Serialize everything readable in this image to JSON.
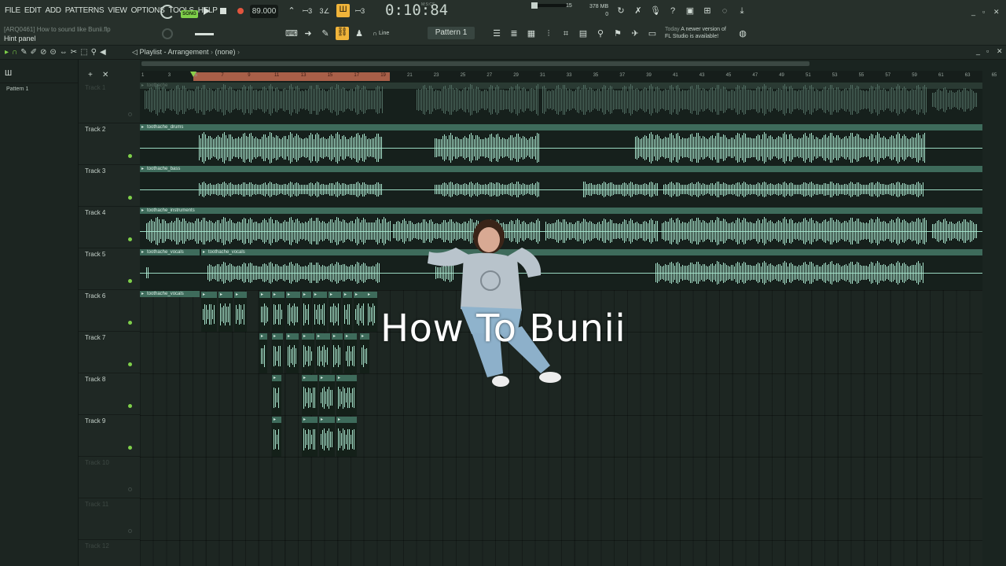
{
  "menu": [
    "FILE",
    "EDIT",
    "ADD",
    "PATTERNS",
    "VIEW",
    "OPTIONS",
    "TOOLS",
    "HELP"
  ],
  "project": "[ARQ0461] How to sound like Bunii.flp",
  "hint_panel": "Hint panel",
  "song_mode": "SONG",
  "tempo": "89.000",
  "time": "0:10:84",
  "time_label": "M:S:CS",
  "cpu_value": "15",
  "memory": "378 MB",
  "memory_sub": "0",
  "snap": "Line",
  "pattern": "Pattern 1",
  "news": {
    "date": "Today",
    "line1": "A newer version of",
    "line2": "FL Studio is available!"
  },
  "playlist_title": "Playlist - Arrangement",
  "playlist_sub": "(none)",
  "picker_items": [
    "Pattern 1"
  ],
  "ruler_numbers": [
    "1",
    "3",
    "5",
    "7",
    "9",
    "11",
    "13",
    "15",
    "17",
    "19",
    "21",
    "23",
    "25",
    "27",
    "29",
    "31",
    "33",
    "35",
    "37",
    "39",
    "41",
    "43",
    "45",
    "47",
    "49",
    "51",
    "53",
    "55",
    "57",
    "59",
    "61",
    "63",
    "65"
  ],
  "tracks": [
    {
      "name": "Track 1",
      "active": false
    },
    {
      "name": "Track 2",
      "active": true
    },
    {
      "name": "Track 3",
      "active": true
    },
    {
      "name": "Track 4",
      "active": true
    },
    {
      "name": "Track 5",
      "active": true
    },
    {
      "name": "Track 6",
      "active": true
    },
    {
      "name": "Track 7",
      "active": true
    },
    {
      "name": "Track 8",
      "active": true
    },
    {
      "name": "Track 9",
      "active": true
    },
    {
      "name": "Track 10",
      "active": false
    },
    {
      "name": "Track 11",
      "active": false
    },
    {
      "name": "Track 12",
      "active": false
    }
  ],
  "clips": {
    "track1": "toothache",
    "drums": "toothache_drums",
    "bass": "toothache_bass",
    "instruments": "toothache_instruments",
    "vocals_a": "toothache_vocals",
    "vocals_b": "toothache_vocals",
    "vocals_c": "toothache_vocals"
  },
  "overlay_title": "How To Bunii",
  "colors": {
    "accent": "#f0b43a",
    "wave": "#a8e3cc",
    "clip_header": "#3e6b5b",
    "selection": "#b8664e",
    "song_button": "#7fd04a"
  }
}
